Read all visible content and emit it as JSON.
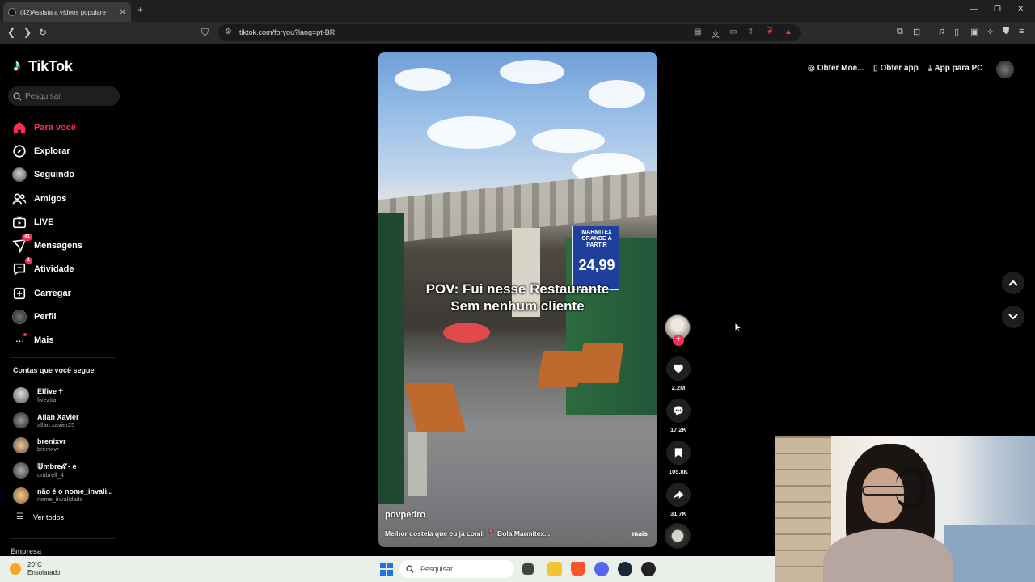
{
  "browser": {
    "tab_title": "(42)Assista a vídeos populare",
    "url": "tiktok.com/foryou?lang=pt-BR"
  },
  "sidebar": {
    "logo": "TikTok",
    "search_placeholder": "Pesquisar",
    "nav": [
      {
        "label": "Para você",
        "icon": "home-icon",
        "active": true
      },
      {
        "label": "Explorar",
        "icon": "compass-icon"
      },
      {
        "label": "Seguindo",
        "icon": "following-avatar-icon"
      },
      {
        "label": "Amigos",
        "icon": "friends-icon"
      },
      {
        "label": "LIVE",
        "icon": "live-icon"
      },
      {
        "label": "Mensagens",
        "icon": "messages-icon",
        "badge": "41"
      },
      {
        "label": "Atividade",
        "icon": "activity-icon",
        "badge": "1"
      },
      {
        "label": "Carregar",
        "icon": "upload-icon"
      },
      {
        "label": "Perfil",
        "icon": "profile-avatar-icon"
      },
      {
        "label": "Mais",
        "icon": "more-icon"
      }
    ],
    "following_title": "Contas que você segue",
    "following": [
      {
        "name": "Elfive 🕆",
        "user": "fivezita"
      },
      {
        "name": "Allan Xavier",
        "user": "allan.xavier25"
      },
      {
        "name": "brenixvr",
        "user": "brenixvr"
      },
      {
        "name": "𝕌mbre𝓁𝓁 - e",
        "user": "umbrell_4"
      },
      {
        "name": "não é o nome_invali...",
        "user": "nome_invalidado"
      }
    ],
    "see_all": "Ver todos",
    "company": "Empresa"
  },
  "video": {
    "caption_line1": "POV: Fui nesse Restaurante",
    "caption_line2": "Sem nenhum cliente",
    "sign_top": "MARMITEX GRANDE À PARTIR",
    "sign_price": "24,99",
    "username": "povpedro",
    "description": "Melhor costela que eu já comi! 📍 Bola Marmitex...",
    "more": "mais"
  },
  "actions": {
    "likes": "2.2M",
    "comments": "17.2K",
    "saves": "105.8K",
    "shares": "31.7K"
  },
  "topbar": {
    "coins": "Obter Moe...",
    "get_app": "Obter app",
    "pc_app": "App para PC"
  },
  "taskbar": {
    "temp": "20°C",
    "condition": "Ensolarado",
    "search": "Pesquisar"
  },
  "colors": {
    "accent": "#fe2c55",
    "background": "#000000"
  }
}
